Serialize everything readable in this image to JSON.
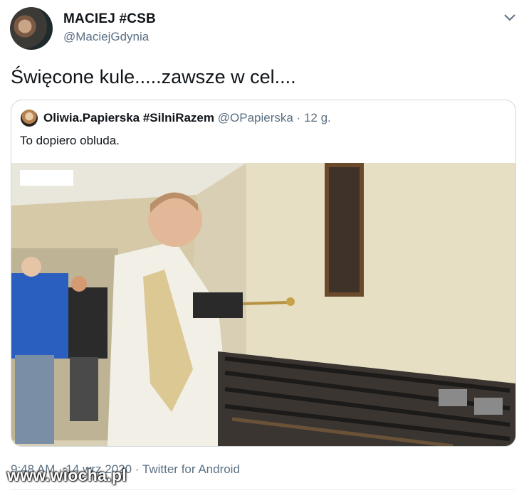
{
  "author": {
    "name": "MACIEJ #CSB",
    "handle": "@MaciejGdynia"
  },
  "tweet": {
    "text": "Święcone kule.....zawsze w cel...."
  },
  "quoted": {
    "name": "Oliwia.Papierska #SilniRazem",
    "handle": "@OPapierska",
    "separator": " · ",
    "time": "12 g.",
    "text": "To dopiero obluda."
  },
  "footer": {
    "time": "9:48 AM · 14 wrz 2020",
    "separator": " · ",
    "source": "Twitter for Android"
  },
  "watermark": "www.wiocha.pl",
  "icons": {
    "menu": "chevron-down-icon"
  }
}
